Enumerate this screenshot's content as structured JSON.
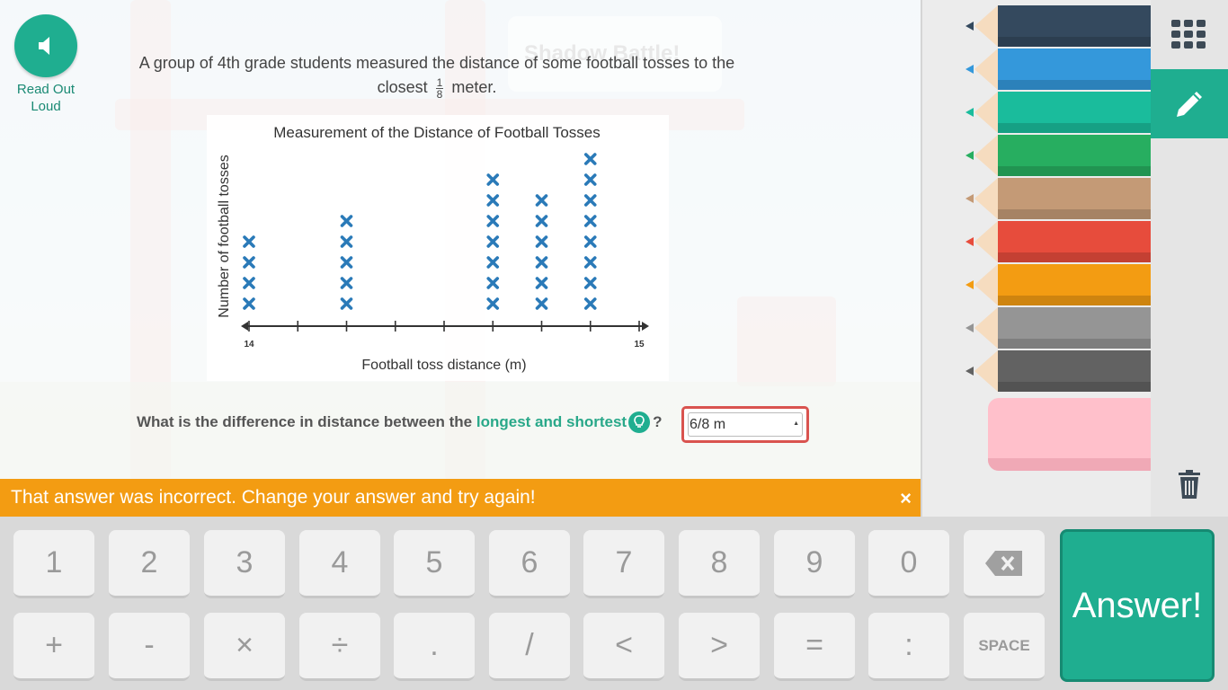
{
  "colors": {
    "accent": "#1fae90",
    "error": "#d9534f",
    "feedback": "#f39c12",
    "mark": "#2a7ab8"
  },
  "read_aloud": {
    "label": "Read Out Loud",
    "icon": "speaker-icon"
  },
  "question": {
    "text_before": "A group of 4th grade students measured the distance of some football tosses to the closest",
    "fraction_num": "1",
    "fraction_den": "8",
    "text_after": "meter."
  },
  "chart_data": {
    "type": "scatter",
    "subtype": "line plot",
    "title": "Measurement of the Distance of Football Tosses",
    "xlabel": "Football toss distance (m)",
    "ylabel": "Number of football tosses",
    "x_tick_labels": [
      "14",
      "",
      "",
      "",
      "",
      "",
      "",
      "",
      "15"
    ],
    "xlim": [
      14,
      15
    ],
    "tick_step": 0.125,
    "points": [
      {
        "x": 14,
        "count": 4
      },
      {
        "x": 14.25,
        "count": 5
      },
      {
        "x": 14.625,
        "count": 7
      },
      {
        "x": 14.75,
        "count": 6
      },
      {
        "x": 14.875,
        "count": 8
      }
    ],
    "marker": "x"
  },
  "sub_question": {
    "before": "What is the difference in distance between the",
    "highlight": "longest and shortest",
    "after": "?"
  },
  "answer": {
    "value": "6/8 m"
  },
  "feedback": {
    "message": "That answer was incorrect. Change your answer and try again!",
    "close": "×"
  },
  "pencils": [
    {
      "name": "navy",
      "color": "#34495e"
    },
    {
      "name": "blue",
      "color": "#3498db"
    },
    {
      "name": "teal",
      "color": "#1abc9c"
    },
    {
      "name": "green",
      "color": "#27ae60"
    },
    {
      "name": "tan",
      "color": "#c49a76"
    },
    {
      "name": "red",
      "color": "#e74c3c"
    },
    {
      "name": "orange",
      "color": "#f39c12"
    },
    {
      "name": "gray",
      "color": "#959595"
    },
    {
      "name": "dark-gray",
      "color": "#626262"
    }
  ],
  "keys_row1": [
    "1",
    "2",
    "3",
    "4",
    "5",
    "6",
    "7",
    "8",
    "9",
    "0"
  ],
  "keys_row2": [
    "+",
    "-",
    "×",
    "÷",
    ".",
    "/",
    "<",
    ">",
    "=",
    ":"
  ],
  "space_label": "SPACE",
  "answer_button": "Answer!"
}
